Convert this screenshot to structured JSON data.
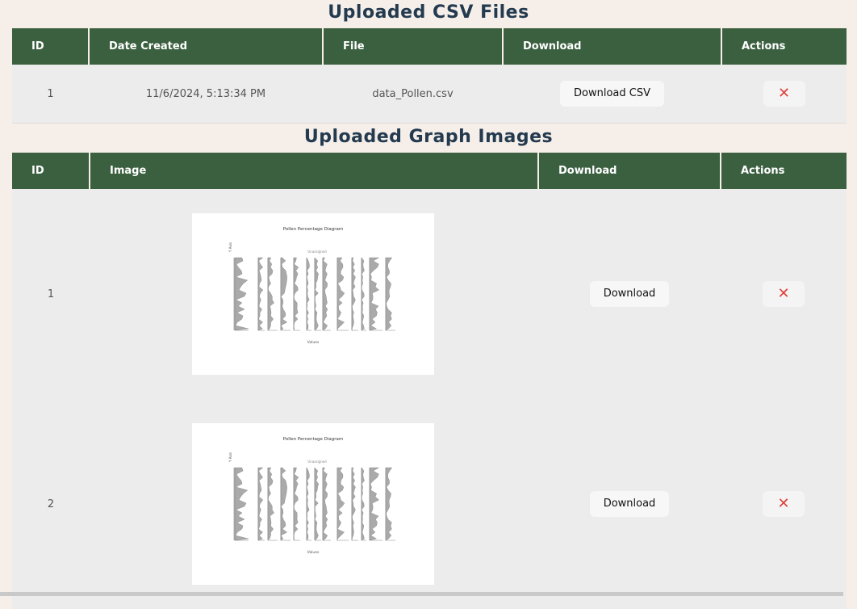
{
  "csv_section": {
    "title": "Uploaded CSV Files",
    "columns": [
      "ID",
      "Date Created",
      "File",
      "Download",
      "Actions"
    ],
    "rows": [
      {
        "id": "1",
        "date": "11/6/2024, 5:13:34 PM",
        "file": "data_Pollen.csv",
        "download_label": "Download CSV",
        "delete_icon": "close-x-icon"
      }
    ]
  },
  "image_section": {
    "title": "Uploaded Graph Images",
    "columns": [
      "ID",
      "Image",
      "Download",
      "Actions"
    ],
    "rows": [
      {
        "id": "1",
        "download_label": "Download",
        "delete_icon": "close-x-icon",
        "thumbnail": {
          "title": "Pollen Percentage Diagram",
          "group_label": "Unassigned",
          "x_label": "Values",
          "y_label": "Y Axis"
        }
      },
      {
        "id": "2",
        "download_label": "Download",
        "delete_icon": "close-x-icon",
        "thumbnail": {
          "title": "Pollen Percentage Diagram",
          "group_label": "Unassigned",
          "x_label": "Values",
          "y_label": "Y Axis"
        }
      }
    ]
  },
  "colors": {
    "background": "#f6efe9",
    "header_green": "#3b6040",
    "title_navy": "#233a4f",
    "delete_red": "#e0403a"
  }
}
